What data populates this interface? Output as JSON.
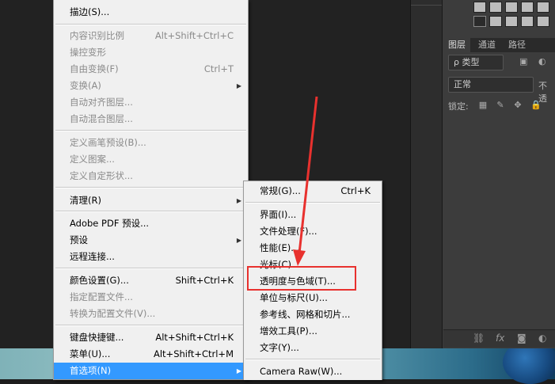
{
  "main_menu": {
    "items": [
      {
        "label": "描边(S)...",
        "shortcut": "",
        "disabled": false
      },
      {
        "label": "内容识别比例",
        "shortcut": "Alt+Shift+Ctrl+C",
        "disabled": true
      },
      {
        "label": "操控变形",
        "shortcut": "",
        "disabled": true
      },
      {
        "label": "自由变换(F)",
        "shortcut": "Ctrl+T",
        "disabled": true
      },
      {
        "label": "变换(A)",
        "shortcut": "",
        "disabled": true
      },
      {
        "label": "自动对齐图层...",
        "shortcut": "",
        "disabled": true
      },
      {
        "label": "自动混合图层...",
        "shortcut": "",
        "disabled": true
      },
      {
        "label": "定义画笔预设(B)...",
        "shortcut": "",
        "disabled": true
      },
      {
        "label": "定义图案...",
        "shortcut": "",
        "disabled": true
      },
      {
        "label": "定义自定形状...",
        "shortcut": "",
        "disabled": true
      },
      {
        "label": "清理(R)",
        "shortcut": "",
        "disabled": false
      },
      {
        "label": "Adobe PDF 预设...",
        "shortcut": "",
        "disabled": false
      },
      {
        "label": "预设",
        "shortcut": "",
        "disabled": false
      },
      {
        "label": "远程连接...",
        "shortcut": "",
        "disabled": false
      },
      {
        "label": "颜色设置(G)...",
        "shortcut": "Shift+Ctrl+K",
        "disabled": false
      },
      {
        "label": "指定配置文件...",
        "shortcut": "",
        "disabled": true
      },
      {
        "label": "转换为配置文件(V)...",
        "shortcut": "",
        "disabled": true
      },
      {
        "label": "键盘快捷键...",
        "shortcut": "Alt+Shift+Ctrl+K",
        "disabled": false
      },
      {
        "label": "菜单(U)...",
        "shortcut": "Alt+Shift+Ctrl+M",
        "disabled": false
      },
      {
        "label": "首选项(N)",
        "shortcut": "",
        "disabled": false,
        "highlighted": true
      }
    ]
  },
  "sub_menu": {
    "items": [
      {
        "label": "常规(G)...",
        "shortcut": "Ctrl+K"
      },
      {
        "label": "界面(I)...",
        "shortcut": ""
      },
      {
        "label": "文件处理(F)...",
        "shortcut": ""
      },
      {
        "label": "性能(E)...",
        "shortcut": ""
      },
      {
        "label": "光标(C)...",
        "shortcut": ""
      },
      {
        "label": "透明度与色域(T)...",
        "shortcut": ""
      },
      {
        "label": "单位与标尺(U)...",
        "shortcut": ""
      },
      {
        "label": "参考线、网格和切片...",
        "shortcut": ""
      },
      {
        "label": "增效工具(P)...",
        "shortcut": ""
      },
      {
        "label": "文字(Y)...",
        "shortcut": ""
      },
      {
        "label": "Camera Raw(W)...",
        "shortcut": ""
      }
    ]
  },
  "layers_panel": {
    "tabs": [
      "图层",
      "通道",
      "路径"
    ],
    "filter_kind": "ρ 类型",
    "blend_mode": "正常",
    "opacity_label": "不透",
    "lock_label": "锁定:"
  },
  "colors": {
    "highlight": "#3399ff",
    "annotation": "#e8312e"
  }
}
